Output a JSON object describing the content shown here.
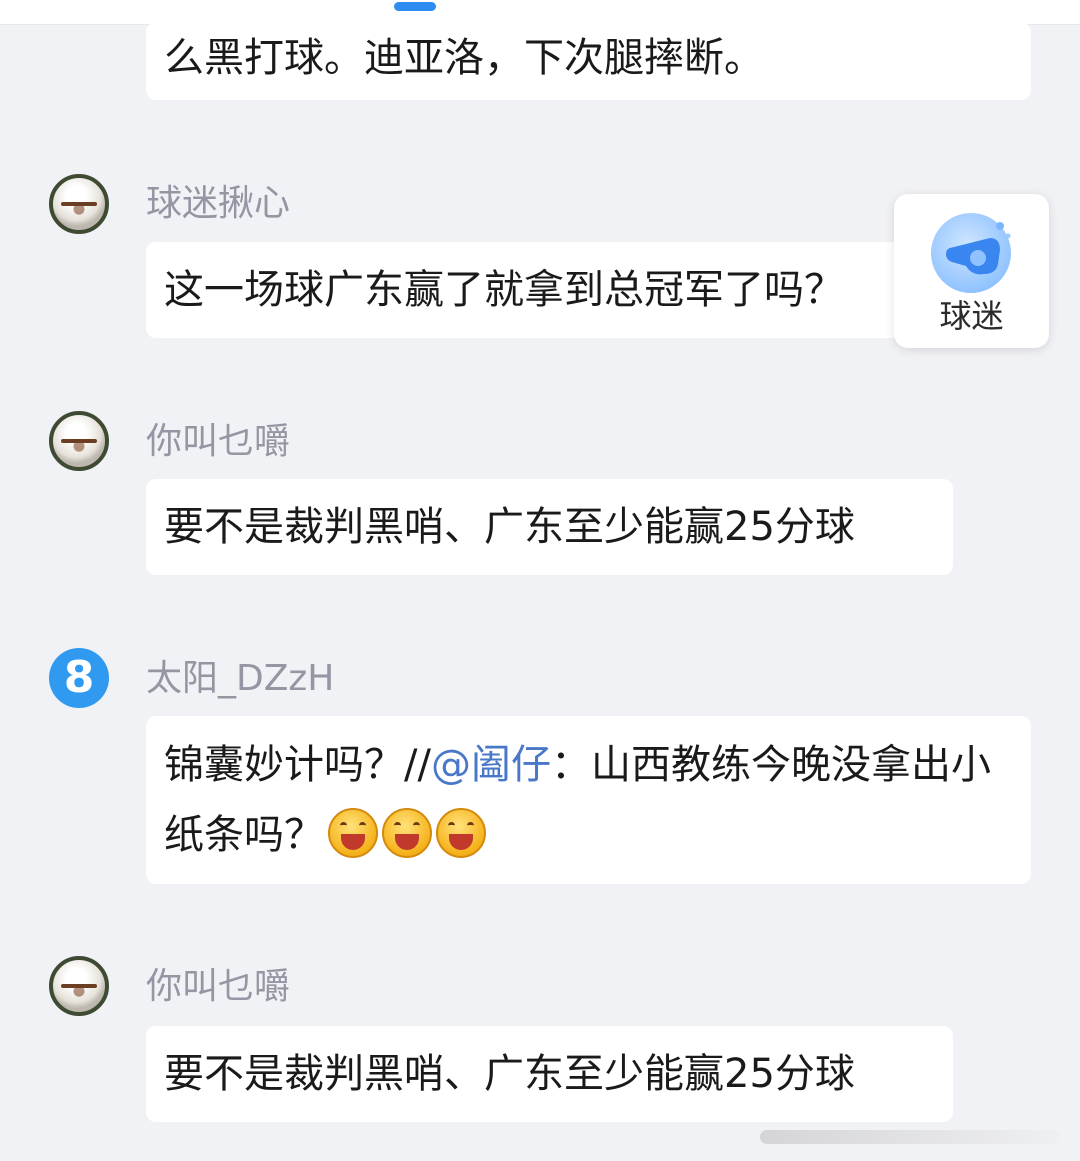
{
  "comments": [
    {
      "text": "么黑打球。迪亚洛，下次腿摔断。"
    },
    {
      "username": "球迷揪心",
      "avatar_icon": "soccer-ball-avatar-icon",
      "text": "这一场球广东赢了就拿到总冠军了吗？"
    },
    {
      "username": "你叫乜嚼",
      "avatar_icon": "soccer-ball-avatar-icon",
      "text": "要不是裁判黑哨、广东至少能赢25分球"
    },
    {
      "username": "太阳_DZzH",
      "avatar_icon": "number-eight-avatar-icon",
      "avatar_text": "8",
      "text_before": "锦囊妙计吗？//",
      "mention": "@阖仔",
      "text_after": "：山西教练今晚没拿出小纸条吗？",
      "emojis": [
        "grinning-face-icon",
        "grinning-face-icon",
        "grinning-face-icon"
      ]
    },
    {
      "username": "你叫乜嚼",
      "avatar_icon": "soccer-ball-avatar-icon",
      "text": "要不是裁判黑哨、广东至少能赢25分球"
    }
  ],
  "floating_button": {
    "label": "球迷",
    "icon": "whistle-icon"
  },
  "colors": {
    "background": "#f1f2f5",
    "bubble": "#ffffff",
    "username": "#9497a3",
    "mention": "#4a78c9",
    "accent": "#2f8cf0"
  }
}
